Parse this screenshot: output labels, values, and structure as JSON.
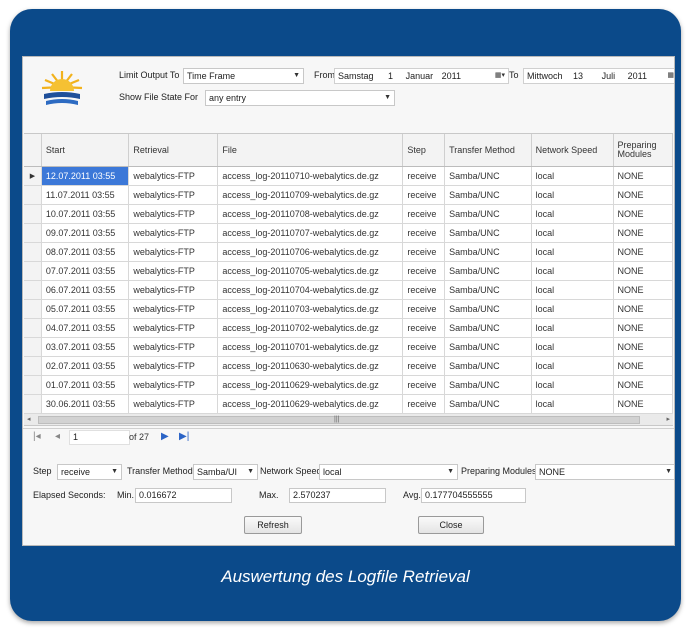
{
  "filter": {
    "limit_label": "Limit Output To",
    "limit_value": "Time Frame",
    "from_label": "From",
    "from_weekday": "Samstag",
    "from_day": "1",
    "from_month": "Januar",
    "from_year": "2011",
    "to_label": "To",
    "to_weekday": "Mittwoch",
    "to_day": "13",
    "to_month": "Juli",
    "to_year": "2011",
    "state_label": "Show File State For",
    "state_value": "any entry"
  },
  "grid": {
    "columns": [
      "Start",
      "Retrieval",
      "File",
      "Step",
      "Transfer Method",
      "Network Speed",
      "Preparing Modules"
    ],
    "rows": [
      [
        "12.07.2011 03:55",
        "webalytics-FTP",
        "access_log-20110710-webalytics.de.gz",
        "receive",
        "Samba/UNC",
        "local",
        "NONE"
      ],
      [
        "11.07.2011 03:55",
        "webalytics-FTP",
        "access_log-20110709-webalytics.de.gz",
        "receive",
        "Samba/UNC",
        "local",
        "NONE"
      ],
      [
        "10.07.2011 03:55",
        "webalytics-FTP",
        "access_log-20110708-webalytics.de.gz",
        "receive",
        "Samba/UNC",
        "local",
        "NONE"
      ],
      [
        "09.07.2011 03:55",
        "webalytics-FTP",
        "access_log-20110707-webalytics.de.gz",
        "receive",
        "Samba/UNC",
        "local",
        "NONE"
      ],
      [
        "08.07.2011 03:55",
        "webalytics-FTP",
        "access_log-20110706-webalytics.de.gz",
        "receive",
        "Samba/UNC",
        "local",
        "NONE"
      ],
      [
        "07.07.2011 03:55",
        "webalytics-FTP",
        "access_log-20110705-webalytics.de.gz",
        "receive",
        "Samba/UNC",
        "local",
        "NONE"
      ],
      [
        "06.07.2011 03:55",
        "webalytics-FTP",
        "access_log-20110704-webalytics.de.gz",
        "receive",
        "Samba/UNC",
        "local",
        "NONE"
      ],
      [
        "05.07.2011 03:55",
        "webalytics-FTP",
        "access_log-20110703-webalytics.de.gz",
        "receive",
        "Samba/UNC",
        "local",
        "NONE"
      ],
      [
        "04.07.2011 03:55",
        "webalytics-FTP",
        "access_log-20110702-webalytics.de.gz",
        "receive",
        "Samba/UNC",
        "local",
        "NONE"
      ],
      [
        "03.07.2011 03:55",
        "webalytics-FTP",
        "access_log-20110701-webalytics.de.gz",
        "receive",
        "Samba/UNC",
        "local",
        "NONE"
      ],
      [
        "02.07.2011 03:55",
        "webalytics-FTP",
        "access_log-20110630-webalytics.de.gz",
        "receive",
        "Samba/UNC",
        "local",
        "NONE"
      ],
      [
        "01.07.2011 03:55",
        "webalytics-FTP",
        "access_log-20110629-webalytics.de.gz",
        "receive",
        "Samba/UNC",
        "local",
        "NONE"
      ],
      [
        "30.06.2011 03:55",
        "webalytics-FTP",
        "access_log-20110629-webalytics.de.gz",
        "receive",
        "Samba/UNC",
        "local",
        "NONE"
      ]
    ]
  },
  "navigator": {
    "position": "1",
    "of_label": "of 27"
  },
  "detail": {
    "step_label": "Step",
    "step_value": "receive",
    "transfer_label": "Transfer Method",
    "transfer_value": "Samba/UI",
    "speed_label": "Network Speed",
    "speed_value": "local",
    "modules_label": "Preparing Modules",
    "modules_value": "NONE",
    "elapsed_label": "Elapsed Seconds:",
    "min_label": "Min.",
    "min_value": "0.016672",
    "max_label": "Max.",
    "max_value": "2.570237",
    "avg_label": "Avg.",
    "avg_value": "0.177704555555"
  },
  "buttons": {
    "refresh": "Refresh",
    "close": "Close"
  },
  "caption": "Auswertung des Logfile Retrieval",
  "colors": {
    "frame": "#0b4a8a",
    "selection": "#3c78d8"
  }
}
